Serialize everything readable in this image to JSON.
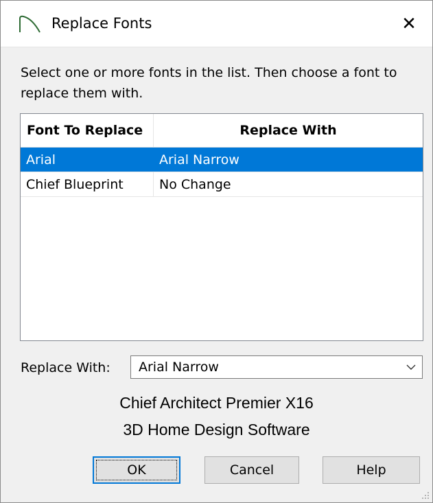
{
  "window": {
    "title": "Replace Fonts",
    "app_icon": "chief-architect-arch-icon",
    "close_glyph": "✕"
  },
  "instructions": "Select one or more fonts in the list.  Then choose a font to replace them with.",
  "font_list": {
    "columns": [
      "Font To Replace",
      "Replace With"
    ],
    "rows": [
      {
        "font": "Arial",
        "replace_with": "Arial Narrow",
        "selected": true
      },
      {
        "font": "Chief Blueprint",
        "replace_with": "No Change",
        "selected": false
      }
    ]
  },
  "replace_with": {
    "label": "Replace With:",
    "value": "Arial Narrow"
  },
  "branding": {
    "line1": "Chief Architect Premier X16",
    "line2": "3D Home Design Software"
  },
  "buttons": {
    "ok": "OK",
    "cancel": "Cancel",
    "help": "Help"
  },
  "colors": {
    "selection": "#0078d7",
    "dialog_bg": "#f0f0f0",
    "focus_border": "#0078d7"
  }
}
